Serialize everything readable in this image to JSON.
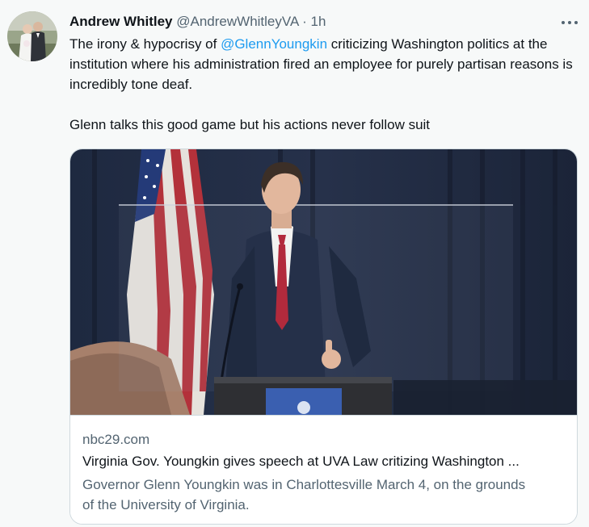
{
  "author": {
    "display_name": "Andrew Whitley",
    "handle": "@AndrewWhitleyVA",
    "separator": "·",
    "timestamp": "1h"
  },
  "tweet": {
    "line1_before": "The irony & hypocrisy of ",
    "mention": "@GlennYoungkin",
    "line1_after": " criticizing Washington politics at the institution where his administration fired an employee for purely partisan reasons is incredibly tone deaf.",
    "line2": "Glenn talks this good game but his actions never follow suit"
  },
  "card": {
    "domain": "nbc29.com",
    "title": "Virginia Gov. Youngkin gives speech at UVA Law critizing Washington ...",
    "description": "Governor Glenn Youngkin was in Charlottesville March 4, on the grounds of the University of Virginia."
  },
  "icons": {
    "more": "more-horizontal-icon"
  },
  "colors": {
    "link": "#1d9bf0",
    "muted": "#536471",
    "text": "#0f1419",
    "border": "#cfd9de",
    "background": "#f7f9f9"
  }
}
